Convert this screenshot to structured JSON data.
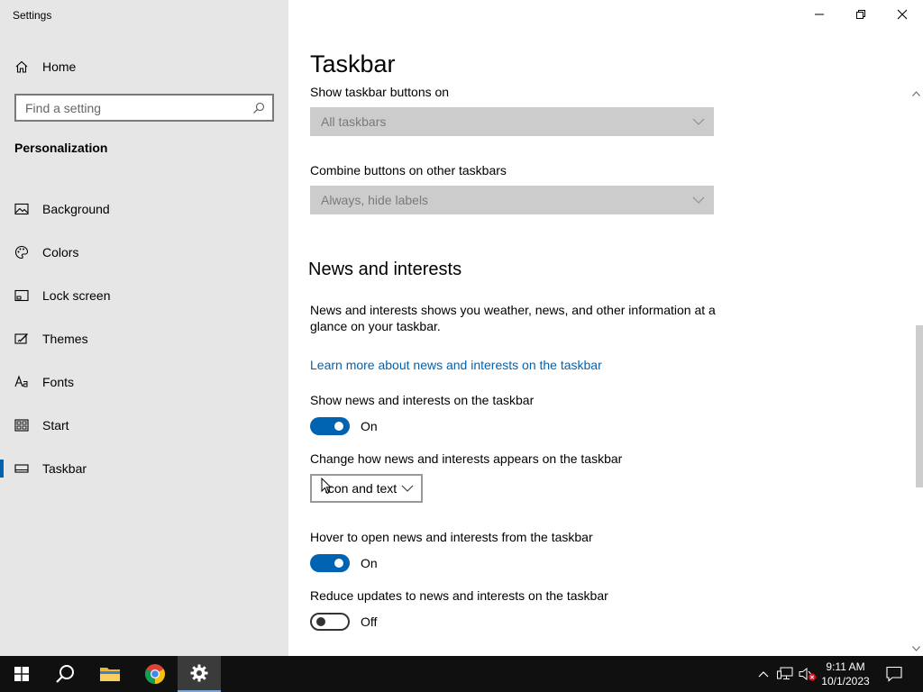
{
  "window": {
    "title": "Settings"
  },
  "sidebar": {
    "home_label": "Home",
    "search_placeholder": "Find a setting",
    "section": "Personalization",
    "items": [
      {
        "label": "Background",
        "icon": "image-icon"
      },
      {
        "label": "Colors",
        "icon": "palette-icon"
      },
      {
        "label": "Lock screen",
        "icon": "lock-screen-icon"
      },
      {
        "label": "Themes",
        "icon": "themes-icon"
      },
      {
        "label": "Fonts",
        "icon": "fonts-icon"
      },
      {
        "label": "Start",
        "icon": "start-icon"
      },
      {
        "label": "Taskbar",
        "icon": "taskbar-icon",
        "active": true
      }
    ]
  },
  "main": {
    "title": "Taskbar",
    "show_buttons": {
      "label": "Show taskbar buttons on",
      "value": "All taskbars"
    },
    "combine_buttons": {
      "label": "Combine buttons on other taskbars",
      "value": "Always, hide labels"
    },
    "news": {
      "heading": "News and interests",
      "description": "News and interests shows you weather, news, and other information at a glance on your taskbar.",
      "link": "Learn more about news and interests on the taskbar",
      "show": {
        "label": "Show news and interests on the taskbar",
        "state": "On"
      },
      "appearance": {
        "label": "Change how news and interests appears on the taskbar",
        "value": "Icon and text"
      },
      "hover": {
        "label": "Hover to open news and interests from the taskbar",
        "state": "On"
      },
      "reduce": {
        "label": "Reduce updates to news and interests on the taskbar",
        "state": "Off"
      }
    }
  },
  "taskbar": {
    "time": "9:11 AM",
    "date": "10/1/2023"
  },
  "colors": {
    "accent": "#0063b1",
    "sidebar_bg": "#e6e6e6",
    "taskbar_bg": "#101010"
  }
}
